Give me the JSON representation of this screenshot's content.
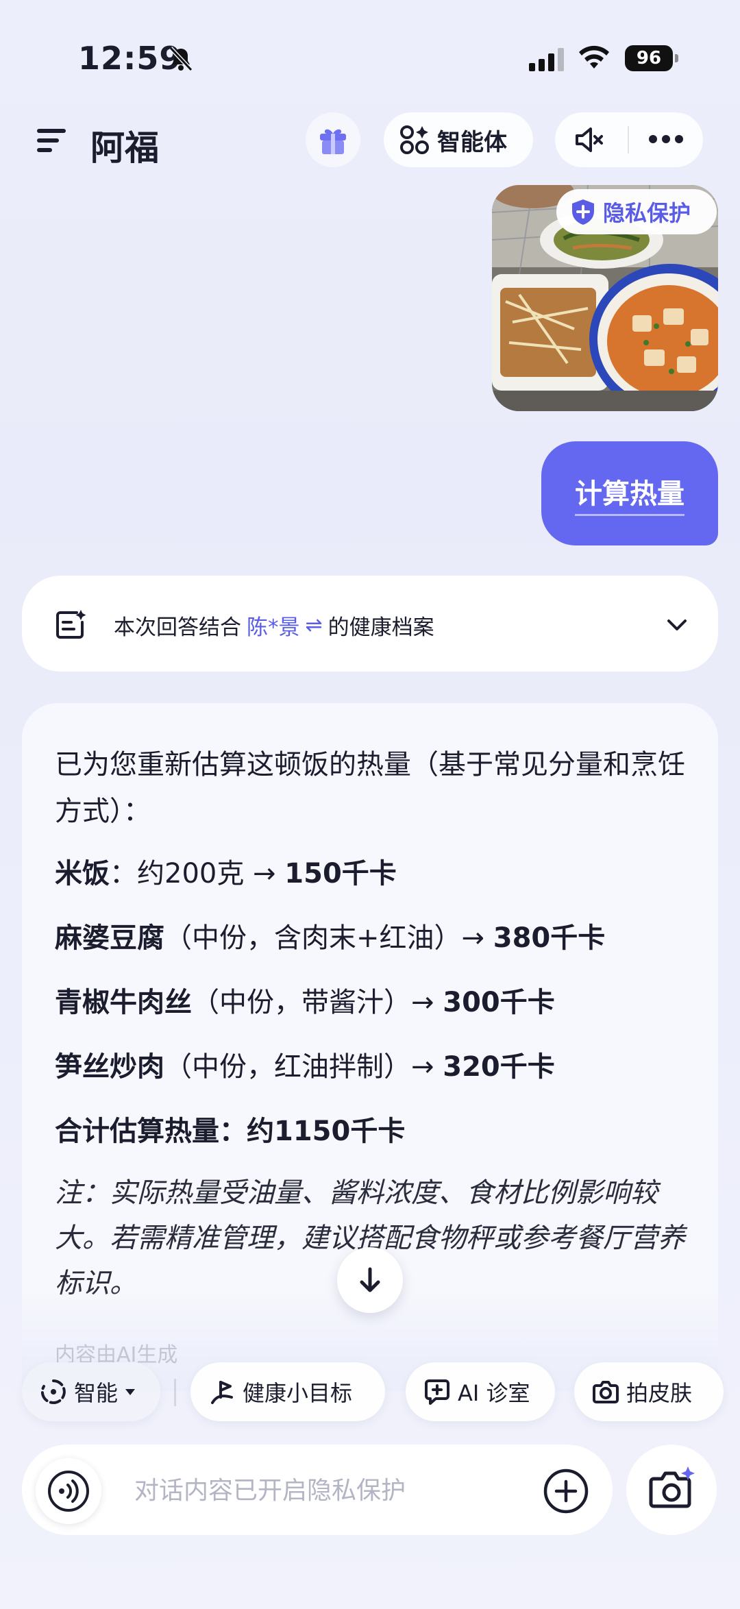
{
  "status_bar": {
    "time": "12:59",
    "battery": "96"
  },
  "header": {
    "title": "阿福",
    "agent_label": "智能体"
  },
  "image_message": {
    "privacy_label": "隐私保护"
  },
  "user_message": "计算热量",
  "health_profile": {
    "prefix": "本次回答结合",
    "name": "陈*景",
    "swap_symbol": "⇌",
    "suffix": "的健康档案"
  },
  "answer": {
    "intro": "已为您重新估算这顿饭的热量（基于常见分量和烹饪方式）：",
    "items": [
      {
        "name": "米饭",
        "detail": "：约200克 → ",
        "kcal": "150千卡"
      },
      {
        "name": "麻婆豆腐",
        "detail": "（中份，含肉末+红油）→ ",
        "kcal": "380千卡"
      },
      {
        "name": "青椒牛肉丝",
        "detail": "（中份，带酱汁）→ ",
        "kcal": "300千卡"
      },
      {
        "name": "笋丝炒肉",
        "detail": "（中份，红油拌制）→ ",
        "kcal": "320千卡"
      }
    ],
    "total": "合计估算热量：约1150千卡",
    "note": "注：实际热量受油量、酱料浓度、食材比例影响较大。若需精准管理，建议搭配食物秤或参考餐厅营养标识。",
    "ai_generated": "内容由AI生成"
  },
  "chips": {
    "mode": "智能",
    "goal": "健康小目标",
    "ai_clinic": "AI 诊室",
    "skin": "拍皮肤"
  },
  "input": {
    "placeholder": "对话内容已开启隐私保护"
  },
  "colors": {
    "accent": "#6467f0",
    "accent_text": "#5a5ce6"
  }
}
